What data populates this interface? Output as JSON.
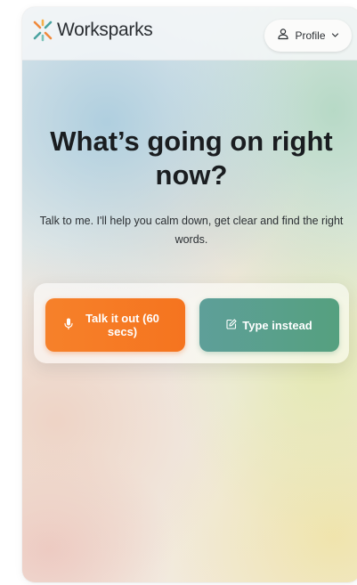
{
  "header": {
    "logo_text": "Worksparks",
    "profile_label": "Profile",
    "profile_icon": "user-icon",
    "chevron_icon": "chevron-down-icon"
  },
  "main": {
    "headline": "What’s going on right now?",
    "subtext": "Talk to me. I'll help you calm down, get clear and find the right words."
  },
  "actions": {
    "talk": {
      "label": "Talk it out (60 secs)",
      "icon": "microphone-icon",
      "color": "#f5781f"
    },
    "type": {
      "label": "Type instead",
      "icon": "edit-icon",
      "color": "#5aa08c"
    }
  },
  "colors": {
    "logo_x_orange": "#f08a3c",
    "logo_x_teal": "#4aa3a0",
    "text_dark": "#1a1d20"
  }
}
